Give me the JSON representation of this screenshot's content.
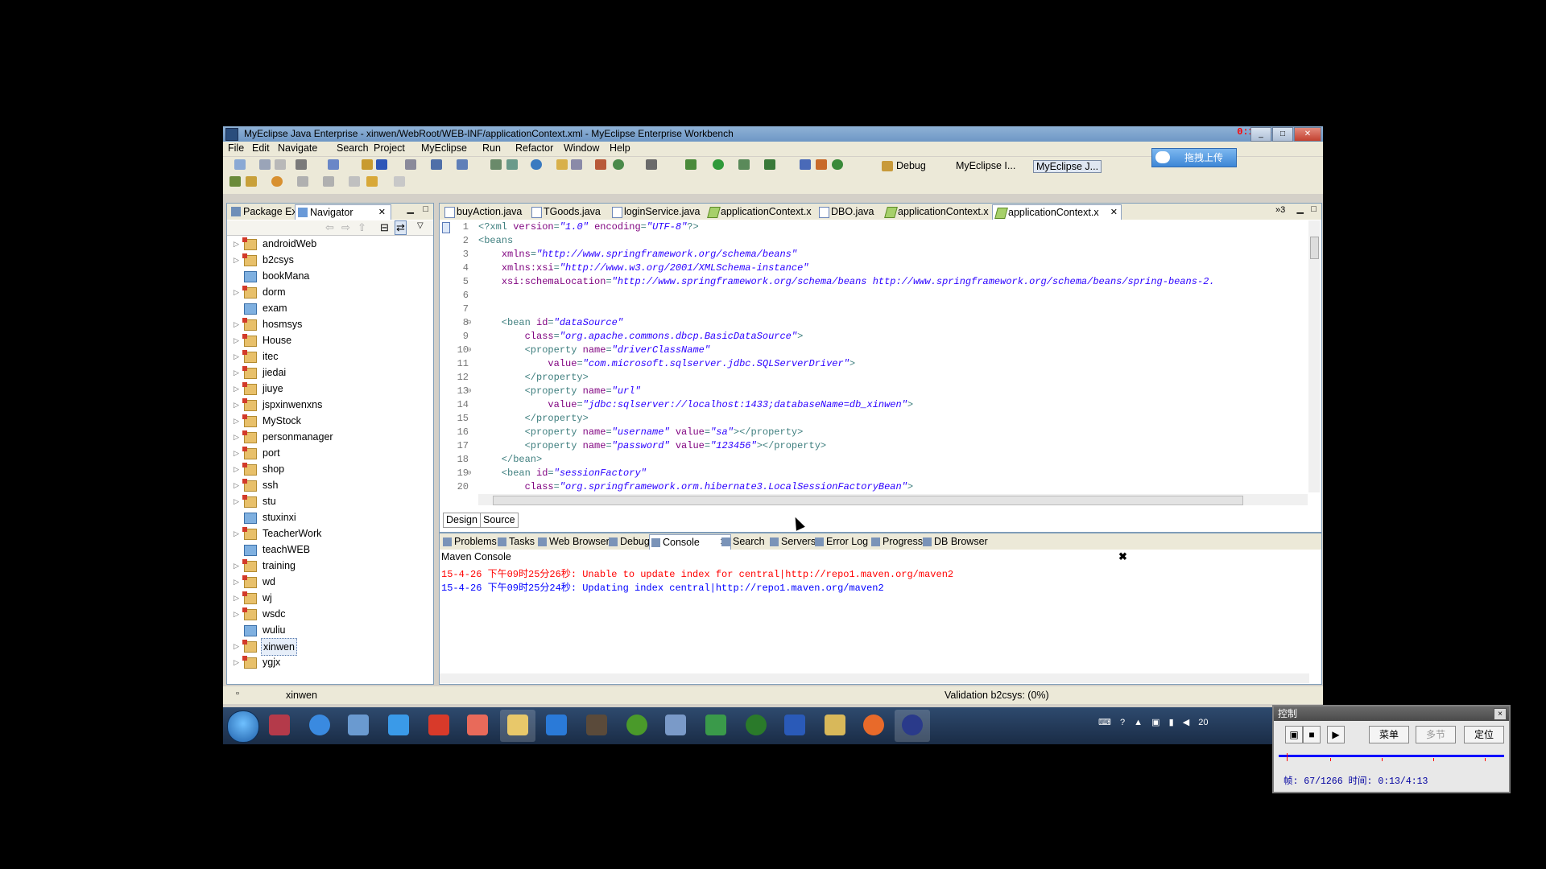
{
  "window": {
    "title": "MyEclipse Java Enterprise - xinwen/WebRoot/WEB-INF/applicationContext.xml - MyEclipse Enterprise Workbench",
    "recording_time": "0:13/4:13"
  },
  "menu": [
    "File",
    "Edit",
    "Navigate",
    "Search",
    "Project",
    "MyEclipse",
    "Run",
    "Refactor",
    "Window",
    "Help"
  ],
  "perspectives": {
    "debug": "Debug",
    "myeclipse_i": "MyEclipse I...",
    "myeclipse_j": "MyEclipse J..."
  },
  "baidu_upload": "拖拽上传",
  "left_tabs": {
    "package": "Package Ex",
    "navigator": "Navigator"
  },
  "tree": [
    {
      "label": "androidWeb",
      "type": "proj",
      "arrow": true
    },
    {
      "label": "b2csys",
      "type": "proj",
      "arrow": true
    },
    {
      "label": "bookMana",
      "type": "web",
      "arrow": false
    },
    {
      "label": "dorm",
      "type": "proj",
      "arrow": true
    },
    {
      "label": "exam",
      "type": "web",
      "arrow": false
    },
    {
      "label": "hosmsys",
      "type": "proj",
      "arrow": true
    },
    {
      "label": "House",
      "type": "proj",
      "arrow": true
    },
    {
      "label": "itec",
      "type": "proj",
      "arrow": true
    },
    {
      "label": "jiedai",
      "type": "proj",
      "arrow": true
    },
    {
      "label": "jiuye",
      "type": "proj",
      "arrow": true
    },
    {
      "label": "jspxinwenxns",
      "type": "proj",
      "arrow": true
    },
    {
      "label": "MyStock",
      "type": "proj",
      "arrow": true
    },
    {
      "label": "personmanager",
      "type": "proj",
      "arrow": true
    },
    {
      "label": "port",
      "type": "proj",
      "arrow": true
    },
    {
      "label": "shop",
      "type": "proj",
      "arrow": true
    },
    {
      "label": "ssh",
      "type": "proj",
      "arrow": true
    },
    {
      "label": "stu",
      "type": "proj",
      "arrow": true
    },
    {
      "label": "stuxinxi",
      "type": "web",
      "arrow": false
    },
    {
      "label": "TeacherWork",
      "type": "proj",
      "arrow": true
    },
    {
      "label": "teachWEB",
      "type": "web",
      "arrow": false
    },
    {
      "label": "training",
      "type": "proj",
      "arrow": true
    },
    {
      "label": "wd",
      "type": "proj",
      "arrow": true
    },
    {
      "label": "wj",
      "type": "proj",
      "arrow": true
    },
    {
      "label": "wsdc",
      "type": "proj",
      "arrow": true
    },
    {
      "label": "wuliu",
      "type": "web",
      "arrow": false
    },
    {
      "label": "xinwen",
      "type": "proj",
      "arrow": true,
      "selected": true
    },
    {
      "label": "ygjx",
      "type": "proj",
      "arrow": true
    }
  ],
  "editor_tabs": [
    {
      "label": "buyAction.java",
      "kind": "java"
    },
    {
      "label": "TGoods.java",
      "kind": "java"
    },
    {
      "label": "loginService.java",
      "kind": "java"
    },
    {
      "label": "applicationContext.x",
      "kind": "xml"
    },
    {
      "label": "DBO.java",
      "kind": "java"
    },
    {
      "label": "applicationContext.x",
      "kind": "xml"
    },
    {
      "label": "applicationContext.x",
      "kind": "xml",
      "active": true
    }
  ],
  "editor_tabs_overflow": "»3",
  "code": [
    {
      "n": "1",
      "segs": [
        [
          "tag",
          "<?xml "
        ],
        [
          "attr",
          "version"
        ],
        [
          "tag",
          "="
        ],
        [
          "val",
          "\"1.0\""
        ],
        [
          "tag",
          " "
        ],
        [
          "attr",
          "encoding"
        ],
        [
          "tag",
          "="
        ],
        [
          "val",
          "\"UTF-8\""
        ],
        [
          "tag",
          "?>"
        ]
      ]
    },
    {
      "n": "2",
      "segs": [
        [
          "tag",
          "<beans"
        ]
      ]
    },
    {
      "n": "3",
      "segs": [
        [
          "tag",
          "    "
        ],
        [
          "attr",
          "xmlns"
        ],
        [
          "tag",
          "="
        ],
        [
          "val",
          "\"http://www.springframework.org/schema/beans\""
        ]
      ]
    },
    {
      "n": "4",
      "segs": [
        [
          "tag",
          "    "
        ],
        [
          "attr",
          "xmlns:xsi"
        ],
        [
          "tag",
          "="
        ],
        [
          "val",
          "\"http://www.w3.org/2001/XMLSchema-instance\""
        ]
      ]
    },
    {
      "n": "5",
      "segs": [
        [
          "tag",
          "    "
        ],
        [
          "attr",
          "xsi:schemaLocation"
        ],
        [
          "tag",
          "="
        ],
        [
          "val",
          "\"http://www.springframework.org/schema/beans http://www.springframework.org/schema/beans/spring-beans-2."
        ]
      ]
    },
    {
      "n": "6",
      "segs": []
    },
    {
      "n": "7",
      "segs": []
    },
    {
      "n": "8",
      "segs": [
        [
          "tag",
          "    <bean "
        ],
        [
          "attr",
          "id"
        ],
        [
          "tag",
          "="
        ],
        [
          "val",
          "\"dataSource\""
        ]
      ]
    },
    {
      "n": "9",
      "segs": [
        [
          "tag",
          "        "
        ],
        [
          "attr",
          "class"
        ],
        [
          "tag",
          "="
        ],
        [
          "val",
          "\"org.apache.commons.dbcp.BasicDataSource\""
        ],
        [
          "tag",
          ">"
        ]
      ]
    },
    {
      "n": "10",
      "segs": [
        [
          "tag",
          "        <property "
        ],
        [
          "attr",
          "name"
        ],
        [
          "tag",
          "="
        ],
        [
          "val",
          "\"driverClassName\""
        ]
      ]
    },
    {
      "n": "11",
      "segs": [
        [
          "tag",
          "            "
        ],
        [
          "attr",
          "value"
        ],
        [
          "tag",
          "="
        ],
        [
          "val",
          "\"com.microsoft.sqlserver.jdbc.SQLServerDriver\""
        ],
        [
          "tag",
          ">"
        ]
      ]
    },
    {
      "n": "12",
      "segs": [
        [
          "tag",
          "        </property>"
        ]
      ]
    },
    {
      "n": "13",
      "segs": [
        [
          "tag",
          "        <property "
        ],
        [
          "attr",
          "name"
        ],
        [
          "tag",
          "="
        ],
        [
          "val",
          "\"url\""
        ]
      ]
    },
    {
      "n": "14",
      "segs": [
        [
          "tag",
          "            "
        ],
        [
          "attr",
          "value"
        ],
        [
          "tag",
          "="
        ],
        [
          "val",
          "\"jdbc:sqlserver://localhost:1433;databaseName=db_xinwen\""
        ],
        [
          "tag",
          ">"
        ]
      ]
    },
    {
      "n": "15",
      "segs": [
        [
          "tag",
          "        </property>"
        ]
      ]
    },
    {
      "n": "16",
      "segs": [
        [
          "tag",
          "        <property "
        ],
        [
          "attr",
          "name"
        ],
        [
          "tag",
          "="
        ],
        [
          "val",
          "\"username\""
        ],
        [
          "tag",
          " "
        ],
        [
          "attr",
          "value"
        ],
        [
          "tag",
          "="
        ],
        [
          "val",
          "\"sa\""
        ],
        [
          "tag",
          "></property>"
        ]
      ]
    },
    {
      "n": "17",
      "segs": [
        [
          "tag",
          "        <property "
        ],
        [
          "attr",
          "name"
        ],
        [
          "tag",
          "="
        ],
        [
          "val",
          "\"password\""
        ],
        [
          "tag",
          " "
        ],
        [
          "attr",
          "value"
        ],
        [
          "tag",
          "="
        ],
        [
          "val",
          "\"123456\""
        ],
        [
          "tag",
          "></property>"
        ]
      ]
    },
    {
      "n": "18",
      "segs": [
        [
          "tag",
          "    </bean>"
        ]
      ]
    },
    {
      "n": "19",
      "segs": [
        [
          "tag",
          "    <bean "
        ],
        [
          "attr",
          "id"
        ],
        [
          "tag",
          "="
        ],
        [
          "val",
          "\"sessionFactory\""
        ]
      ]
    },
    {
      "n": "20",
      "segs": [
        [
          "tag",
          "        "
        ],
        [
          "attr",
          "class"
        ],
        [
          "tag",
          "="
        ],
        [
          "val",
          "\"org.springframework.orm.hibernate3.LocalSessionFactoryBean\""
        ],
        [
          "tag",
          ">"
        ]
      ]
    }
  ],
  "fold_lines": [
    "8",
    "10",
    "13",
    "19"
  ],
  "design_tab": "Design",
  "source_tab": "Source",
  "bottom_tabs": [
    "Problems",
    "Tasks",
    "Web Browser",
    "Debug",
    "Console",
    "Search",
    "Servers",
    "Error Log",
    "Progress",
    "DB Browser"
  ],
  "console": {
    "title": "Maven Console",
    "lines": [
      {
        "kind": "err",
        "text": "15-4-26 下午09时25分26秒: Unable to update index for central|http://repo1.maven.org/maven2"
      },
      {
        "kind": "info",
        "text": "15-4-26 下午09时25分24秒: Updating index central|http://repo1.maven.org/maven2"
      }
    ]
  },
  "status": {
    "selected": "xinwen",
    "validation": "Validation b2csys: (0%)"
  },
  "tray_clock": "20",
  "control_widget": {
    "title": "控制",
    "close": "×",
    "buttons": {
      "menu": "菜单",
      "multi": "多节",
      "locate": "定位"
    },
    "status_text": "帧: 67/1266 时间: 0:13/4:13"
  }
}
